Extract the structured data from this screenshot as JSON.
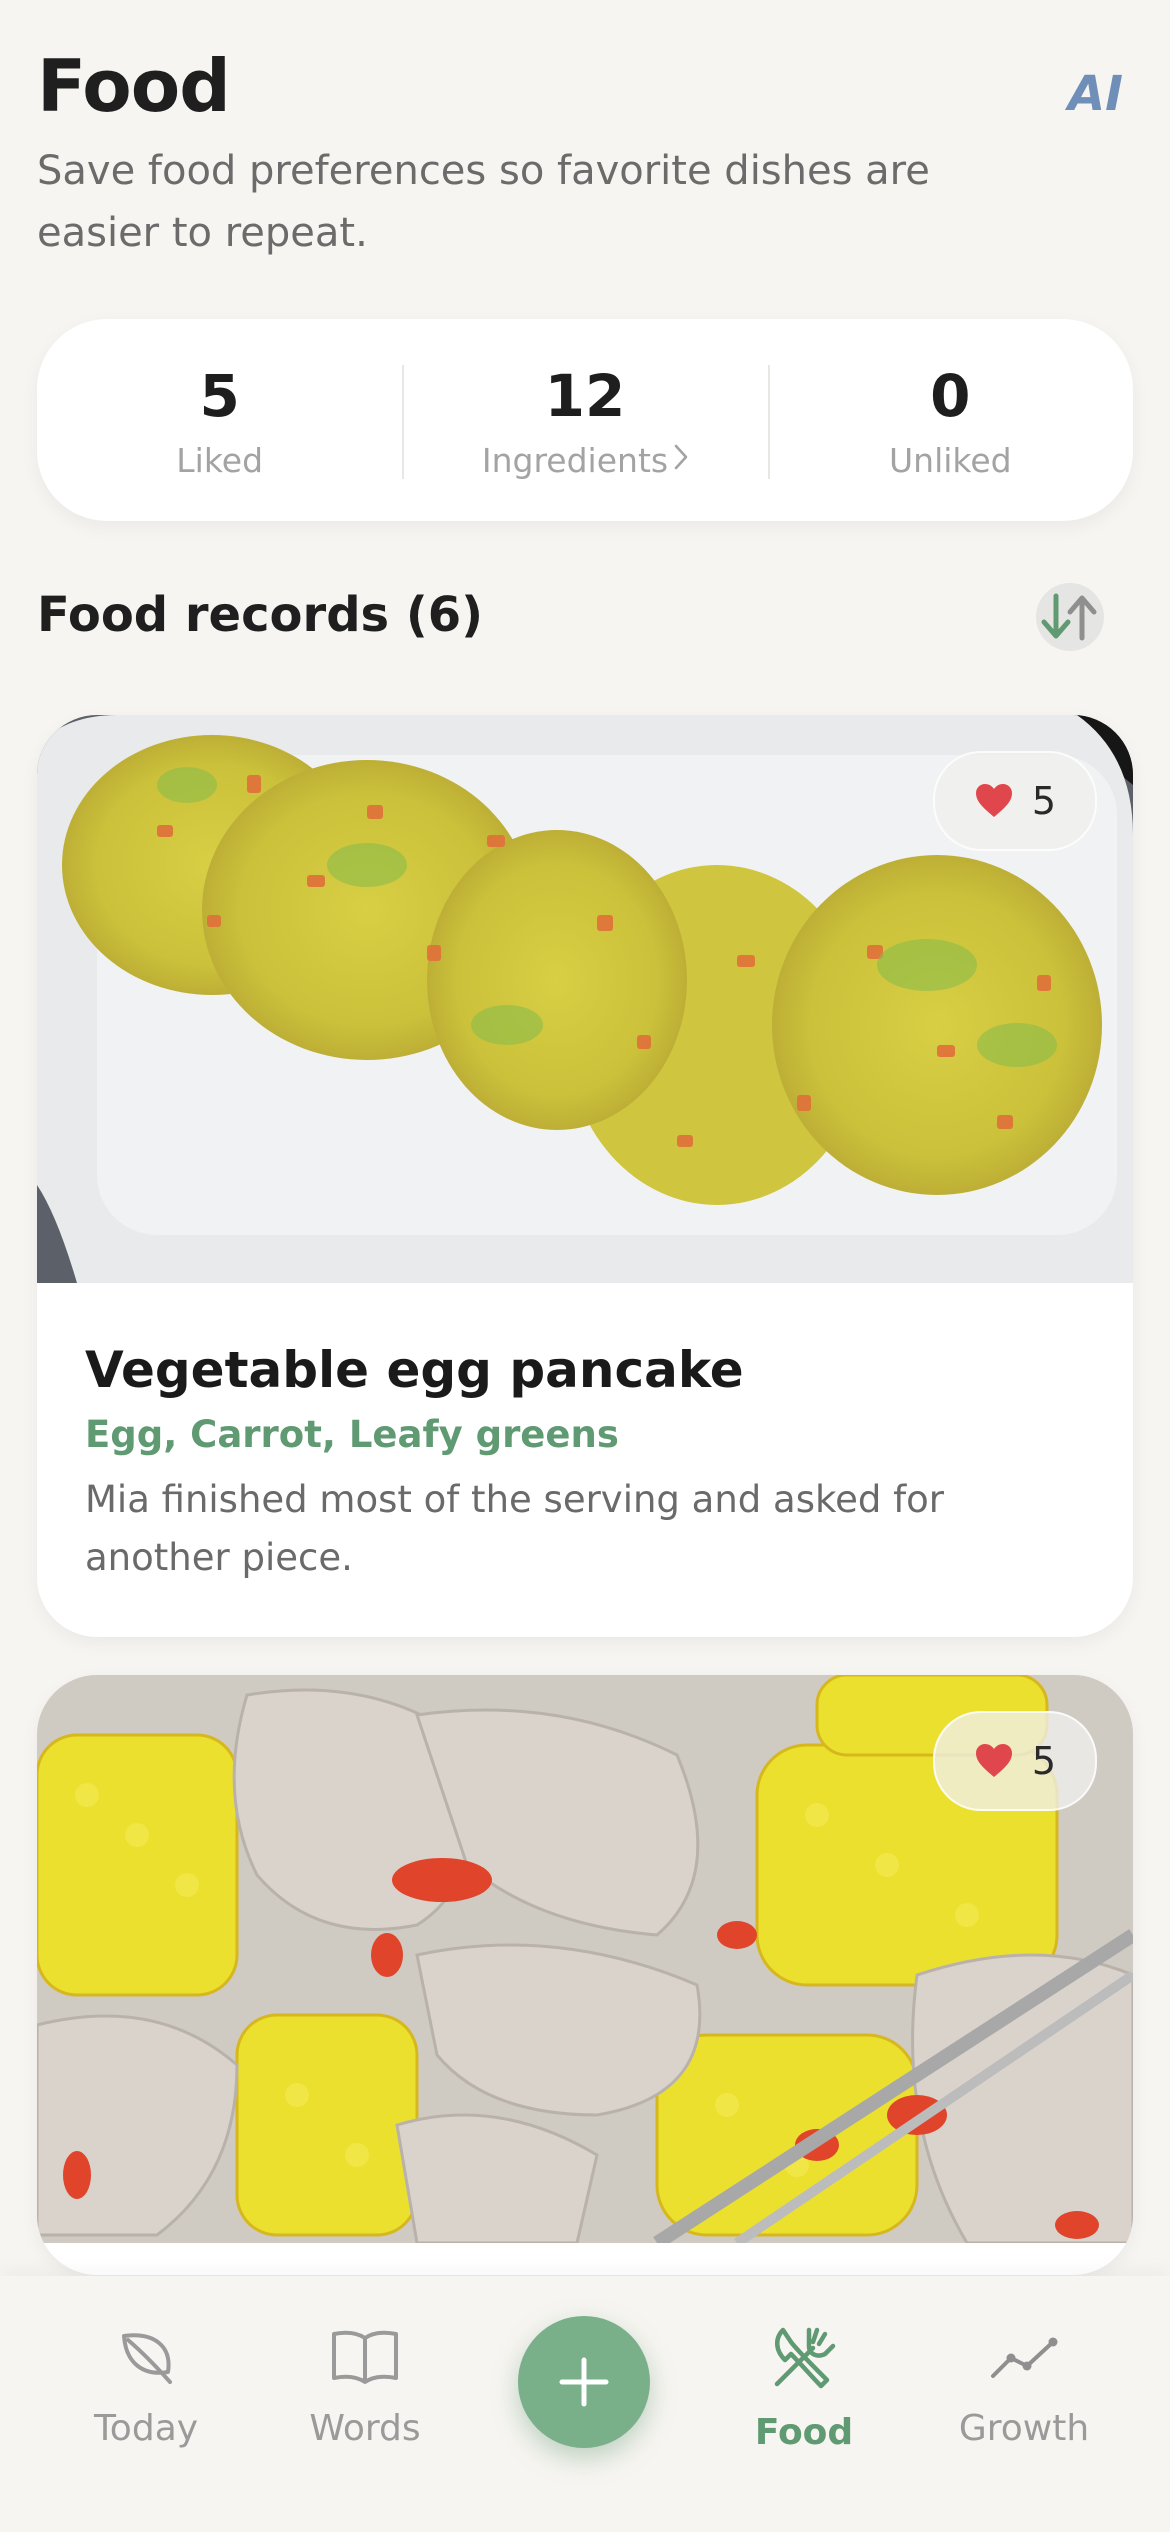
{
  "header": {
    "title": "Food",
    "ai_label": "AI",
    "subtitle": "Save food preferences so favorite dishes are easier to repeat."
  },
  "stats": {
    "liked": {
      "value": "5",
      "label": "Liked"
    },
    "ingredients": {
      "value": "12",
      "label": "Ingredients"
    },
    "unliked": {
      "value": "0",
      "label": "Unliked"
    }
  },
  "records": {
    "title": "Food records (6)",
    "items": [
      {
        "name": "Vegetable egg pancake",
        "ingredients": "Egg, Carrot, Leafy greens",
        "note": "Mia finished most of the serving and asked for another piece.",
        "likes": "5"
      },
      {
        "likes": "5"
      }
    ]
  },
  "tabbar": {
    "today": "Today",
    "words": "Words",
    "food": "Food",
    "growth": "Growth"
  },
  "colors": {
    "accent_green": "#5f9a72",
    "fab_green": "#79b08a",
    "ai_blue": "#6f8fb8",
    "heart_red": "#e0474c",
    "background": "#f7f5f1"
  },
  "icons": [
    "sort-icon",
    "heart-icon",
    "leaf-icon",
    "book-icon",
    "plus-icon",
    "utensils-icon",
    "trend-icon",
    "chevron-right-icon"
  ]
}
